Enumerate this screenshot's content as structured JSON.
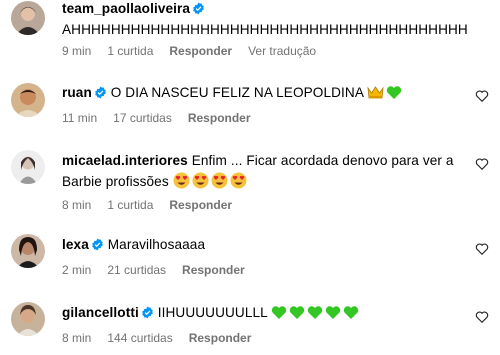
{
  "comments": [
    {
      "username": "team_paollaoliveira",
      "verified": true,
      "text": "AHHHHHHHHHHHHHHHHHHHHHHHHHHHHHHHHHHHHHHHH",
      "time": "9 min",
      "likes": "1 curtida",
      "reply": "Responder",
      "translate": "Ver tradução"
    },
    {
      "username": "ruan",
      "verified": true,
      "text": "O DIA NASCEU FELIZ NA LEOPOLDINA",
      "emojis": [
        "crown",
        "green-heart"
      ],
      "time": "11 min",
      "likes": "17 curtidas",
      "reply": "Responder"
    },
    {
      "username": "micaelad.interiores",
      "verified": false,
      "text": "Enfim ... Ficar acordada denovo para ver a Barbie profissões",
      "emojis": [
        "heart-eyes",
        "heart-eyes",
        "heart-eyes",
        "heart-eyes"
      ],
      "time": "8 min",
      "likes": "1 curtida",
      "reply": "Responder"
    },
    {
      "username": "lexa",
      "verified": true,
      "text": "Maravilhosaaaa",
      "time": "2 min",
      "likes": "21 curtidas",
      "reply": "Responder"
    },
    {
      "username": "gilancellotti",
      "verified": true,
      "text": "IIHUUUUUUULLL",
      "emojis": [
        "green-heart",
        "green-heart",
        "green-heart",
        "green-heart",
        "green-heart"
      ],
      "time": "8 min",
      "likes": "144 curtidas",
      "reply": "Responder"
    }
  ],
  "colors": {
    "verified_badge": "#0095f6",
    "meta_text": "#737373",
    "green_heart": "#34c724"
  },
  "icons": [
    "verified-badge-icon",
    "like-heart-icon",
    "crown-emoji",
    "green-heart-emoji",
    "heart-eyes-emoji"
  ]
}
